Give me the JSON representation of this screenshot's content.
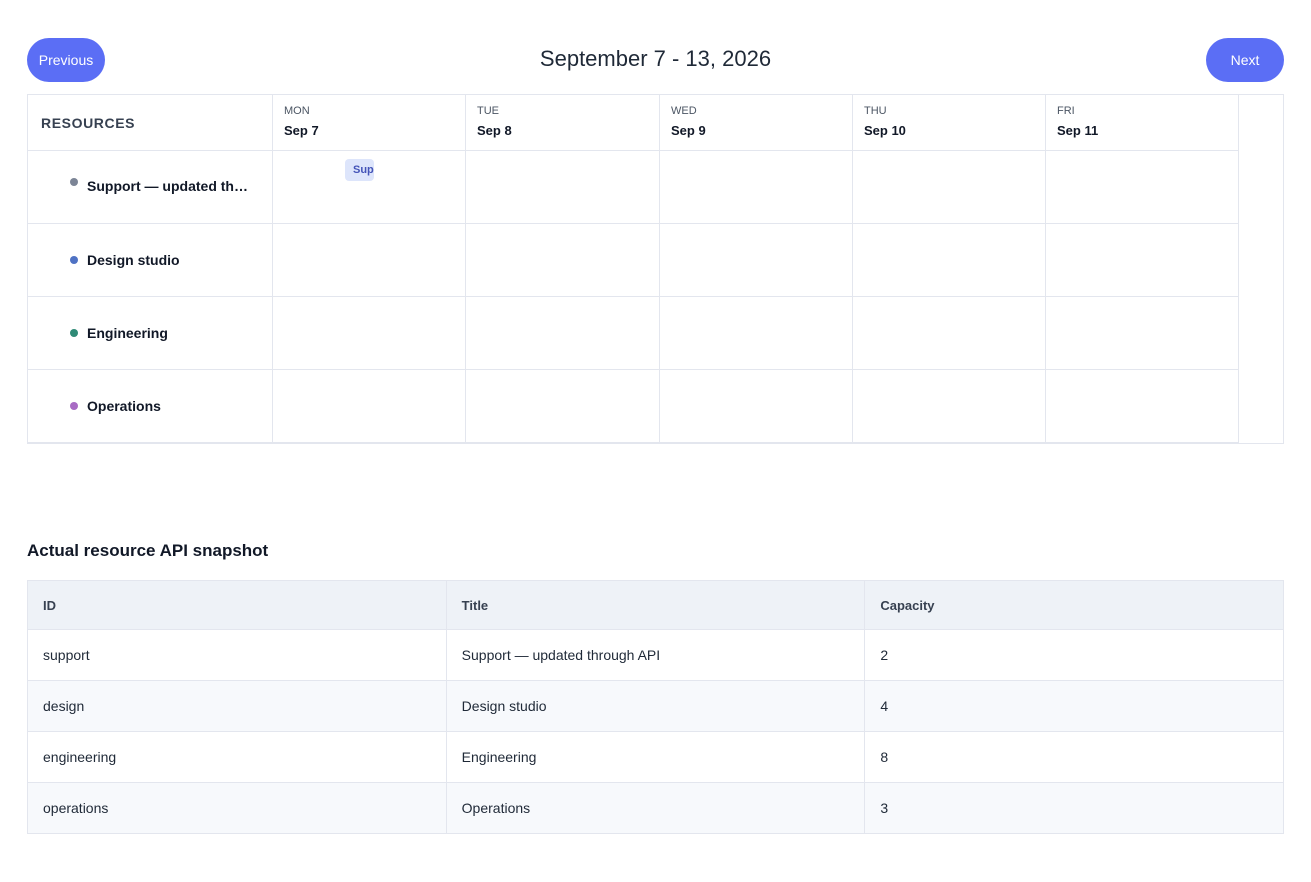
{
  "nav": {
    "previous_label": "Previous",
    "next_label": "Next",
    "range_title": "September 7 - 13, 2026"
  },
  "scheduler": {
    "resources_header": "RESOURCES",
    "days": [
      {
        "name": "MON",
        "date": "Sep 7"
      },
      {
        "name": "TUE",
        "date": "Sep 8"
      },
      {
        "name": "WED",
        "date": "Sep 9"
      },
      {
        "name": "THU",
        "date": "Sep 10"
      },
      {
        "name": "FRI",
        "date": "Sep 11"
      }
    ],
    "resources": [
      {
        "name": "Support — updated th…",
        "color": "#7c8596"
      },
      {
        "name": "Design studio",
        "color": "#4f72c4"
      },
      {
        "name": "Engineering",
        "color": "#2f8a76"
      },
      {
        "name": "Operations",
        "color": "#a86bc4"
      }
    ],
    "event": {
      "label": "Support — updated through API",
      "visible_text": "Sup"
    }
  },
  "snapshot": {
    "title": "Actual resource API snapshot",
    "columns": [
      "ID",
      "Title",
      "Capacity"
    ],
    "rows": [
      {
        "id": "support",
        "title": "Support — updated through API",
        "capacity": "2"
      },
      {
        "id": "design",
        "title": "Design studio",
        "capacity": "4"
      },
      {
        "id": "engineering",
        "title": "Engineering",
        "capacity": "8"
      },
      {
        "id": "operations",
        "title": "Operations",
        "capacity": "3"
      }
    ]
  },
  "colors": {
    "accent": "#5b6ef5",
    "event_bg": "#dde5fb",
    "table_header_bg": "#eef2f7"
  }
}
